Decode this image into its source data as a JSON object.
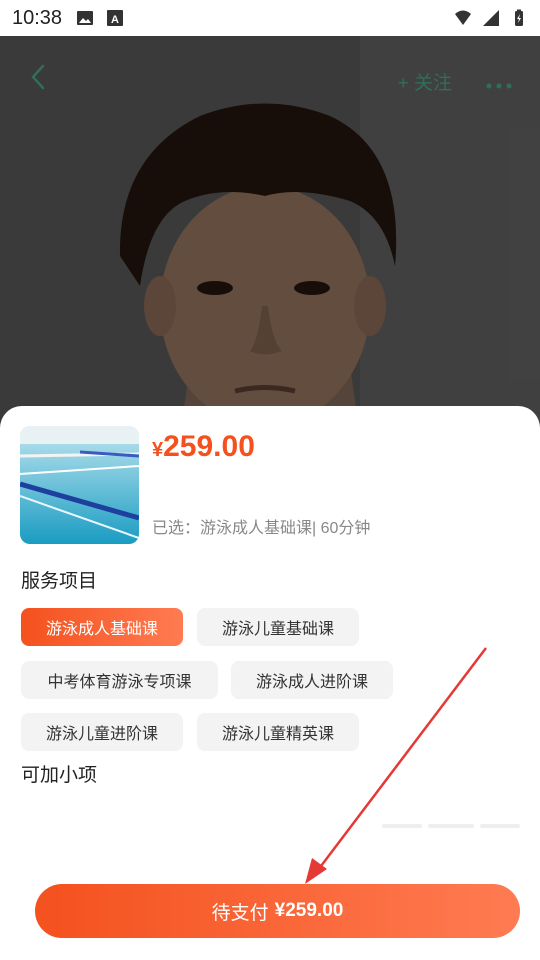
{
  "status_bar": {
    "time": "10:38",
    "left_icons": [
      "image-icon",
      "font-icon"
    ],
    "right_icons": [
      "wifi-icon",
      "signal-icon",
      "battery-icon"
    ]
  },
  "nav": {
    "back_icon": "chevron-left-icon",
    "follow_label": "+ 关注",
    "more_icon": "more-dots-icon"
  },
  "product": {
    "currency": "¥",
    "price": "259.00",
    "selected_text": "已选：游泳成人基础课| 60分钟"
  },
  "services": {
    "title": "服务项目",
    "items": [
      {
        "label": "游泳成人基础课",
        "active": true
      },
      {
        "label": "游泳儿童基础课",
        "active": false
      },
      {
        "label": "中考体育游泳专项课",
        "active": false
      },
      {
        "label": "游泳成人进阶课",
        "active": false
      },
      {
        "label": "游泳儿童进阶课",
        "active": false
      },
      {
        "label": "游泳儿童精英课",
        "active": false
      }
    ]
  },
  "addons": {
    "title": "可加小项"
  },
  "pay_button": {
    "label": "待支付",
    "amount": "¥259.00"
  },
  "colors": {
    "accent": "#f4511e",
    "accent_light": "#ff7b52",
    "nav_green": "#2f6e5a",
    "annotation_arrow": "#e53935"
  }
}
